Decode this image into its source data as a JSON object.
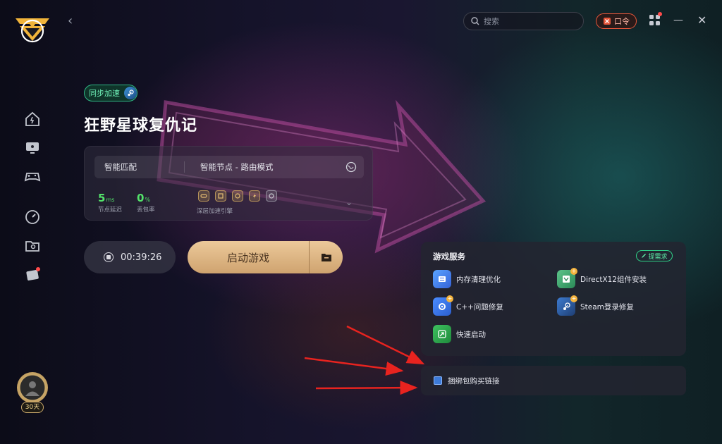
{
  "topbar": {
    "search_placeholder": "搜索",
    "koulin_label": "口令"
  },
  "sidebar": {
    "avatar_days": "30天"
  },
  "game": {
    "sync_label": "同步加速",
    "title": "狂野星球复仇记"
  },
  "node_panel": {
    "smart_match": "智能匹配",
    "node_mode": "智能节点 - 路由模式",
    "latency_value": "5",
    "latency_unit": "ms",
    "latency_label": "节点延迟",
    "loss_value": "0",
    "loss_unit": "%",
    "loss_label": "丢包率",
    "engine_label": "深层加速引擎"
  },
  "actions": {
    "timer": "00:39:26",
    "launch_label": "启动游戏"
  },
  "services": {
    "title": "游戏服务",
    "demand_label": "提需求",
    "items": [
      {
        "label": "内存清理优化"
      },
      {
        "label": "DirectX12组件安装"
      },
      {
        "label": "C++问题修复"
      },
      {
        "label": "Steam登录修复"
      },
      {
        "label": "快速启动"
      }
    ]
  },
  "bundle": {
    "label": "捆绑包购买链接"
  },
  "colors": {
    "accent_green": "#53e36a",
    "launch_gold": "#e0b582",
    "koulin_red": "#e7563a"
  }
}
